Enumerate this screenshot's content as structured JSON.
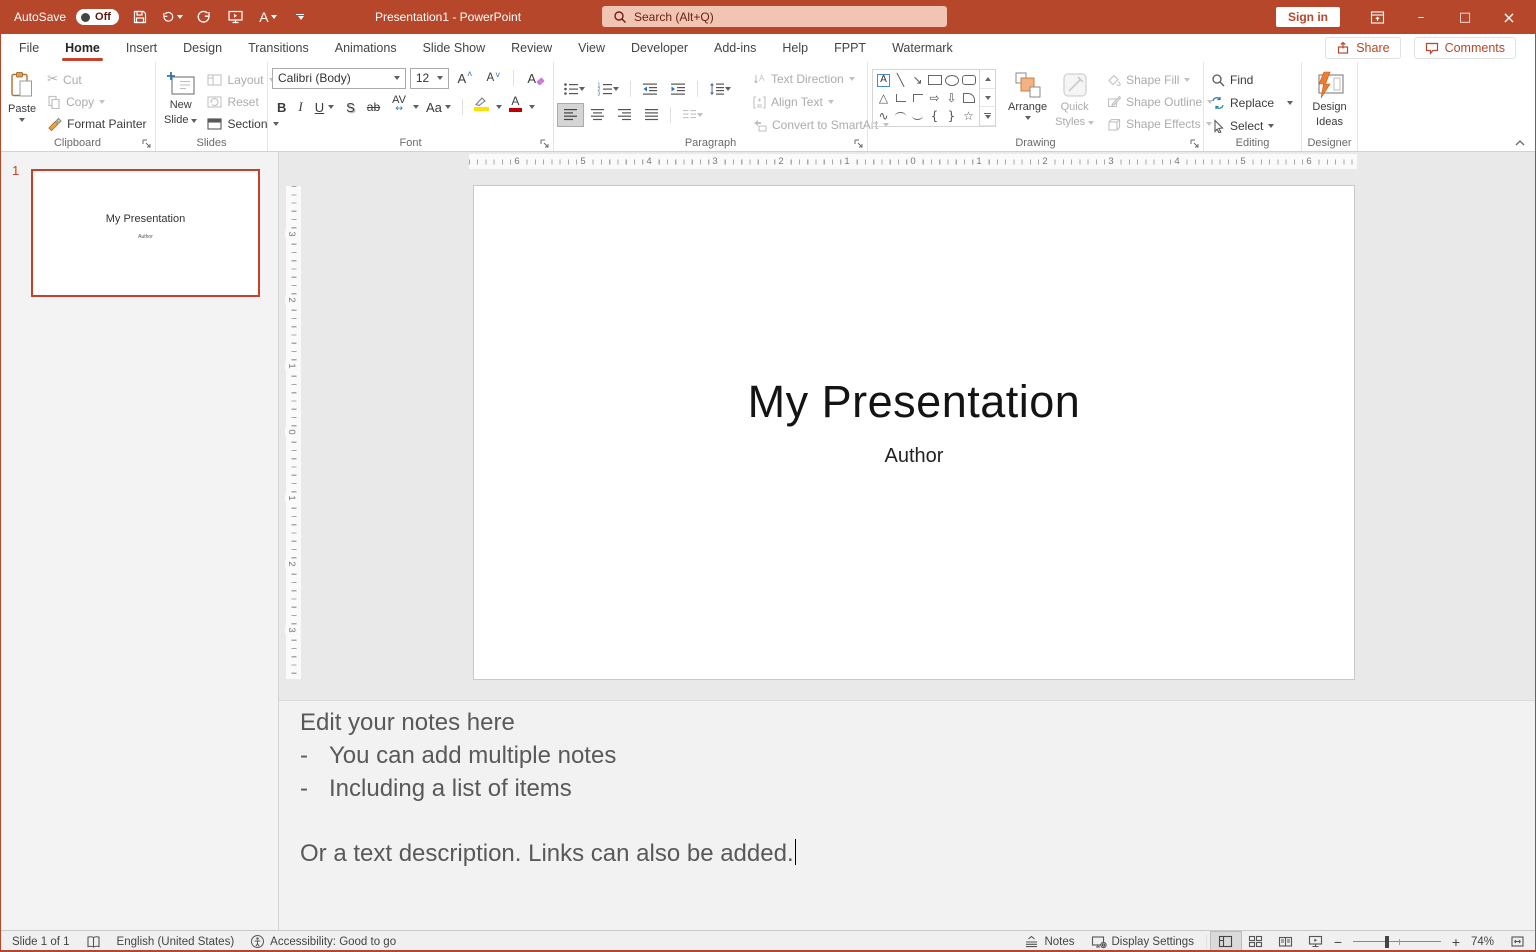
{
  "titlebar": {
    "autosave_label": "AutoSave",
    "autosave_state": "Off",
    "qat_a": "A",
    "title": "Presentation1 - PowerPoint",
    "search_placeholder": "Search (Alt+Q)",
    "sign_in_label": "Sign in",
    "window_controls": {
      "minimize": "–",
      "maximize": "□",
      "close": "×"
    }
  },
  "tabs": [
    {
      "label": "File"
    },
    {
      "label": "Home"
    },
    {
      "label": "Insert"
    },
    {
      "label": "Design"
    },
    {
      "label": "Transitions"
    },
    {
      "label": "Animations"
    },
    {
      "label": "Slide Show"
    },
    {
      "label": "Review"
    },
    {
      "label": "View"
    },
    {
      "label": "Developer"
    },
    {
      "label": "Add-ins"
    },
    {
      "label": "Help"
    },
    {
      "label": "FPPT"
    },
    {
      "label": "Watermark"
    }
  ],
  "tab_actions": {
    "share": "Share",
    "comments": "Comments"
  },
  "ribbon": {
    "clipboard": {
      "group": "Clipboard",
      "paste": "Paste",
      "cut": "Cut",
      "copy": "Copy",
      "format_painter": "Format Painter",
      "cut_glyph": "✂"
    },
    "slides": {
      "group": "Slides",
      "new_line1": "New",
      "new_line2": "Slide",
      "layout": "Layout",
      "reset": "Reset",
      "section": "Section"
    },
    "font": {
      "group": "Font",
      "name": "Calibri (Body)",
      "size": "12",
      "bold": "B",
      "italic": "I",
      "underline": "U",
      "strikethrough": "S",
      "strike_ab": "ab",
      "spacing_av": "AV",
      "case_aa": "Aa",
      "grow_a": "A",
      "shrink_a": "A",
      "clear_a": "A",
      "color_a": "A",
      "spacing_arrow": "↔"
    },
    "paragraph": {
      "group": "Paragraph",
      "text_direction": "Text Direction",
      "align_text": "Align Text",
      "convert": "Convert to SmartArt"
    },
    "drawing": {
      "group": "Drawing",
      "arrange": "Arrange",
      "quick1": "Quick",
      "quick2": "Styles",
      "shape_fill": "Shape Fill",
      "shape_outline": "Shape Outline",
      "shape_effects": "Shape Effects",
      "shapes": [
        {
          "name": "text-box",
          "glyph": "A"
        },
        {
          "name": "line",
          "glyph": "╲"
        },
        {
          "name": "arrow",
          "glyph": "↘"
        },
        {
          "name": "rectangle",
          "glyph": ""
        },
        {
          "name": "oval",
          "glyph": ""
        },
        {
          "name": "rounded-rectangle",
          "glyph": ""
        },
        {
          "name": "triangle",
          "glyph": "△"
        },
        {
          "name": "elbow",
          "glyph": ""
        },
        {
          "name": "elbow-arrow",
          "glyph": ""
        },
        {
          "name": "right-arrow",
          "glyph": "⇨"
        },
        {
          "name": "down-arrow",
          "glyph": "⇩"
        },
        {
          "name": "snip-corner",
          "glyph": ""
        },
        {
          "name": "scribble",
          "glyph": "∿"
        },
        {
          "name": "arc",
          "glyph": ""
        },
        {
          "name": "curve",
          "glyph": ""
        },
        {
          "name": "left-brace",
          "glyph": "{"
        },
        {
          "name": "right-brace",
          "glyph": "}"
        },
        {
          "name": "star",
          "glyph": "☆"
        }
      ]
    },
    "editing": {
      "group": "Editing",
      "find": "Find",
      "replace": "Replace",
      "select": "Select"
    },
    "designer": {
      "group": "Designer",
      "line1": "Design",
      "line2": "Ideas"
    }
  },
  "slide_panel": {
    "number": "1",
    "title": "My Presentation",
    "subtitle": "Author"
  },
  "slide": {
    "title": "My Presentation",
    "subtitle": "Author"
  },
  "rulers": {
    "horizontal": [
      "6",
      "5",
      "4",
      "3",
      "2",
      "1",
      "0",
      "1",
      "2",
      "3",
      "4",
      "5",
      "6"
    ],
    "vertical": [
      "3",
      "2",
      "1",
      "0",
      "1",
      "2",
      "3"
    ]
  },
  "notes": {
    "heading": "Edit your notes here",
    "bullet_char": "-",
    "bullets": [
      "You can add multiple notes",
      "Including a list of items"
    ],
    "paragraph": "Or a text description. Links can also be added."
  },
  "statusbar": {
    "slide_info": "Slide 1 of 1",
    "language": "English (United States)",
    "accessibility": "Accessibility: Good to go",
    "notes": "Notes",
    "display_settings": "Display Settings",
    "zoom": "74%"
  },
  "colors": {
    "accent": "#B7472A",
    "search_bg": "#F2C4B3",
    "grayed": "#ACACAC",
    "highlight_yellow": "#FFE000",
    "font_red": "#C00000",
    "bolt_orange": "#ED7D31"
  }
}
